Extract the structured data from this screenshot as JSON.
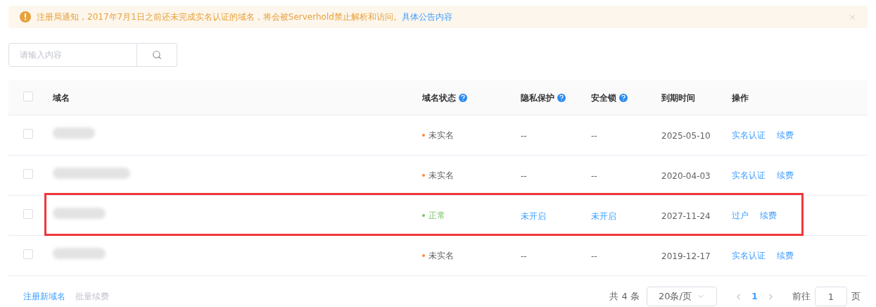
{
  "notice": {
    "text": "注册局通知，2017年7月1日之前还未完成实名认证的域名，将会被Serverhold禁止解析和访问。",
    "link": "具体公告内容"
  },
  "search": {
    "placeholder": "请输入内容"
  },
  "table": {
    "all_checked": false,
    "columns": [
      {
        "label": "域名",
        "help": false
      },
      {
        "label": "域名状态",
        "help": true
      },
      {
        "label": "隐私保护",
        "help": true
      },
      {
        "label": "安全锁",
        "help": true
      },
      {
        "label": "到期时间",
        "help": false
      },
      {
        "label": "操作",
        "help": false
      }
    ],
    "rows": [
      {
        "checked": false,
        "highlighted": false,
        "status": {
          "text": "未实名",
          "color": "#ff8a3d"
        },
        "privacy": {
          "text": "--",
          "kind": "plain"
        },
        "lock": {
          "text": "--",
          "kind": "plain"
        },
        "expiry": "2025-05-10",
        "actions": [
          "实名认证",
          "续费"
        ]
      },
      {
        "checked": false,
        "highlighted": false,
        "status": {
          "text": "未实名",
          "color": "#ff8a3d"
        },
        "privacy": {
          "text": "--",
          "kind": "plain"
        },
        "lock": {
          "text": "--",
          "kind": "plain"
        },
        "expiry": "2020-04-03",
        "actions": [
          "实名认证",
          "续费"
        ]
      },
      {
        "checked": false,
        "highlighted": true,
        "status": {
          "text": "正常",
          "color": "#7ac36a"
        },
        "privacy": {
          "text": "未开启",
          "kind": "link"
        },
        "lock": {
          "text": "未开启",
          "kind": "link"
        },
        "expiry": "2027-11-24",
        "actions": [
          "过户",
          "续费"
        ]
      },
      {
        "checked": false,
        "highlighted": false,
        "status": {
          "text": "未实名",
          "color": "#ff8a3d"
        },
        "privacy": {
          "text": "--",
          "kind": "plain"
        },
        "lock": {
          "text": "--",
          "kind": "plain"
        },
        "expiry": "2019-12-17",
        "actions": [
          "实名认证",
          "续费"
        ]
      }
    ]
  },
  "footer": {
    "register": "注册新域名",
    "bulk_renew": {
      "text": "批量续费",
      "disabled": true
    },
    "total": "共 4 条",
    "page_size": "20条/页",
    "pages": [
      {
        "label": "1",
        "selected": true
      }
    ],
    "goto_label": "前往",
    "goto_value": "1",
    "goto_suffix": "页"
  }
}
